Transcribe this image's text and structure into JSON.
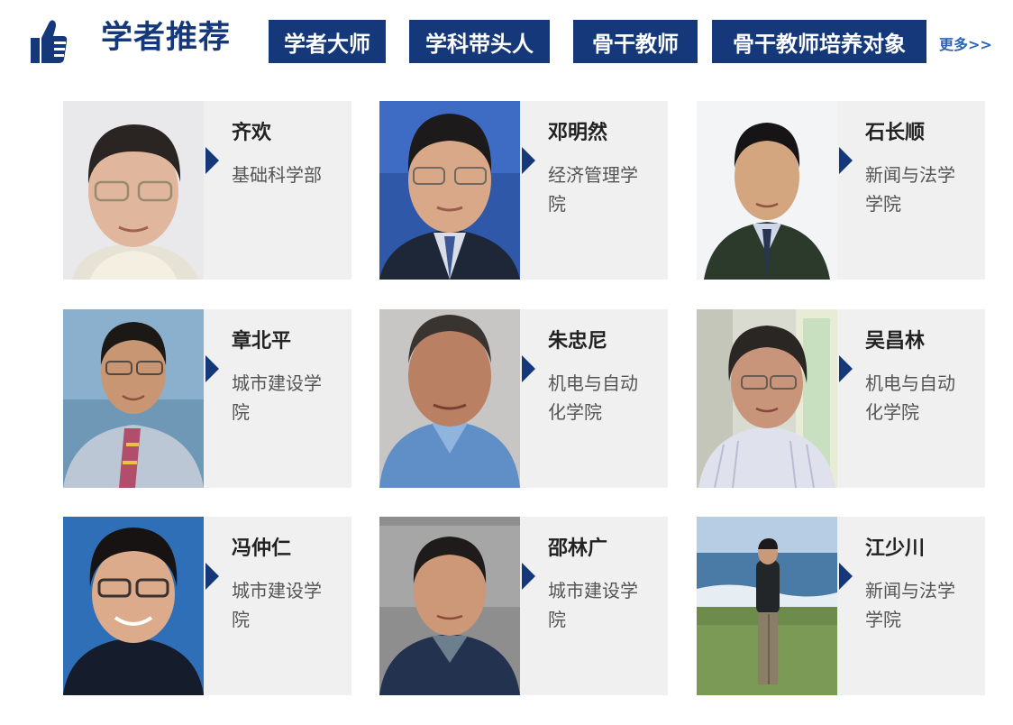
{
  "header": {
    "title": "学者推荐",
    "tabs": [
      "学者大师",
      "学科带头人",
      "骨干教师",
      "骨干教师培养对象"
    ],
    "more": "更多>>"
  },
  "colors": {
    "accent": "#14387a",
    "card_bg": "#f0f0f0",
    "more_link": "#2c65b4"
  },
  "scholars": [
    {
      "name": "齐欢",
      "dept": "基础科学部"
    },
    {
      "name": "邓明然",
      "dept": "经济管理学院"
    },
    {
      "name": "石长顺",
      "dept": "新闻与法学学院"
    },
    {
      "name": "章北平",
      "dept": "城市建设学院"
    },
    {
      "name": "朱忠尼",
      "dept": "机电与自动化学院"
    },
    {
      "name": "吴昌林",
      "dept": "机电与自动化学院"
    },
    {
      "name": "冯仲仁",
      "dept": "城市建设学院"
    },
    {
      "name": "邵林广",
      "dept": "城市建设学院"
    },
    {
      "name": "江少川",
      "dept": "新闻与法学学院"
    }
  ]
}
